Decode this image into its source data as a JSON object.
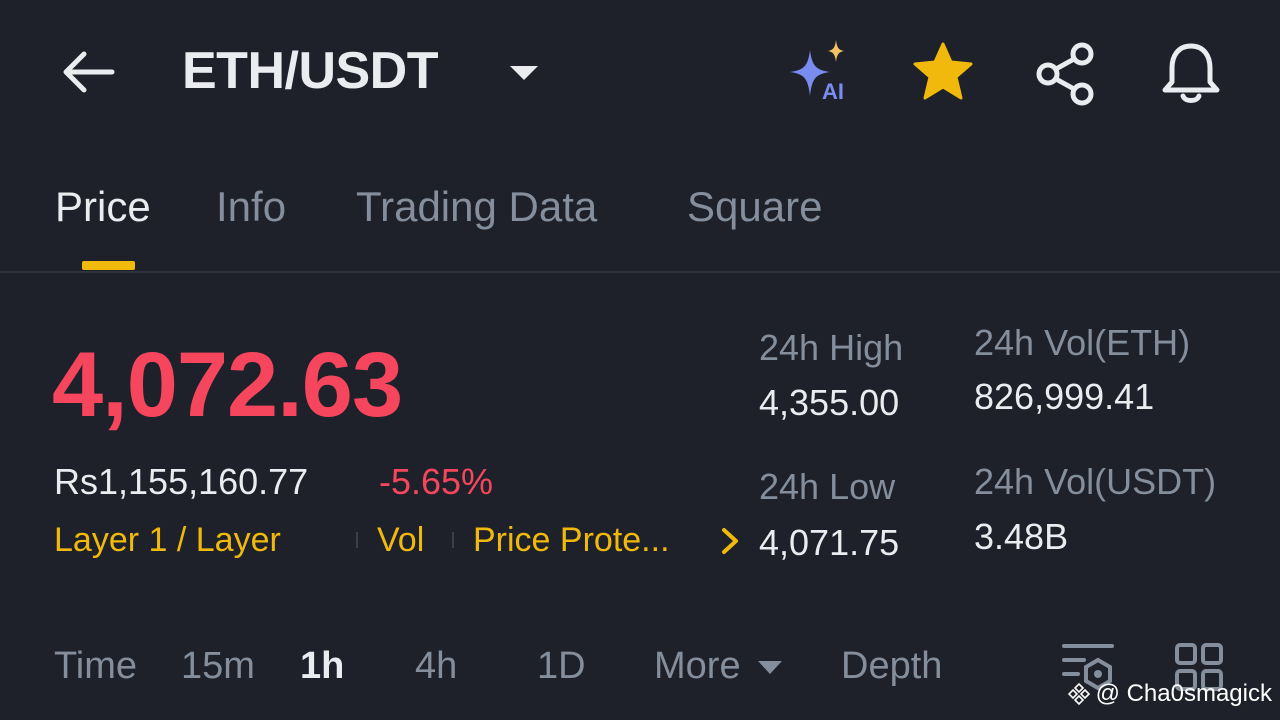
{
  "header": {
    "back_icon": "arrow-left-icon",
    "title": "ETH/USDT",
    "actions": [
      {
        "name": "ai-sparkle-icon",
        "label": "AI"
      },
      {
        "name": "star-icon"
      },
      {
        "name": "share-icon"
      },
      {
        "name": "bell-icon"
      }
    ]
  },
  "tabs": [
    {
      "label": "Price",
      "active": true
    },
    {
      "label": "Info"
    },
    {
      "label": "Trading Data"
    },
    {
      "label": "Square"
    }
  ],
  "ticker": {
    "last_price": "4,072.63",
    "fiat_value": "Rs1,155,160.77",
    "change_pct": "-5.65%",
    "tags": [
      "Layer 1 / Layer",
      "Vol",
      "Price Prote..."
    ],
    "stats": {
      "high_label": "24h High",
      "high_value": "4,355.00",
      "low_label": "24h Low",
      "low_value": "4,071.75",
      "vol_eth_label": "24h Vol(ETH)",
      "vol_eth_value": "826,999.41",
      "vol_usdt_label": "24h Vol(USDT)",
      "vol_usdt_value": "3.48B"
    }
  },
  "intervals": {
    "items": [
      "Time",
      "15m",
      "1h",
      "4h",
      "1D",
      "More",
      "Depth"
    ],
    "active": "1h"
  },
  "watermark": "@ Cha0smagick",
  "colors": {
    "background": "#1e2129",
    "down_red": "#f6465d",
    "accent_yellow": "#f0b90b",
    "muted_text": "#848e9c",
    "primary_text": "#eaecef"
  }
}
